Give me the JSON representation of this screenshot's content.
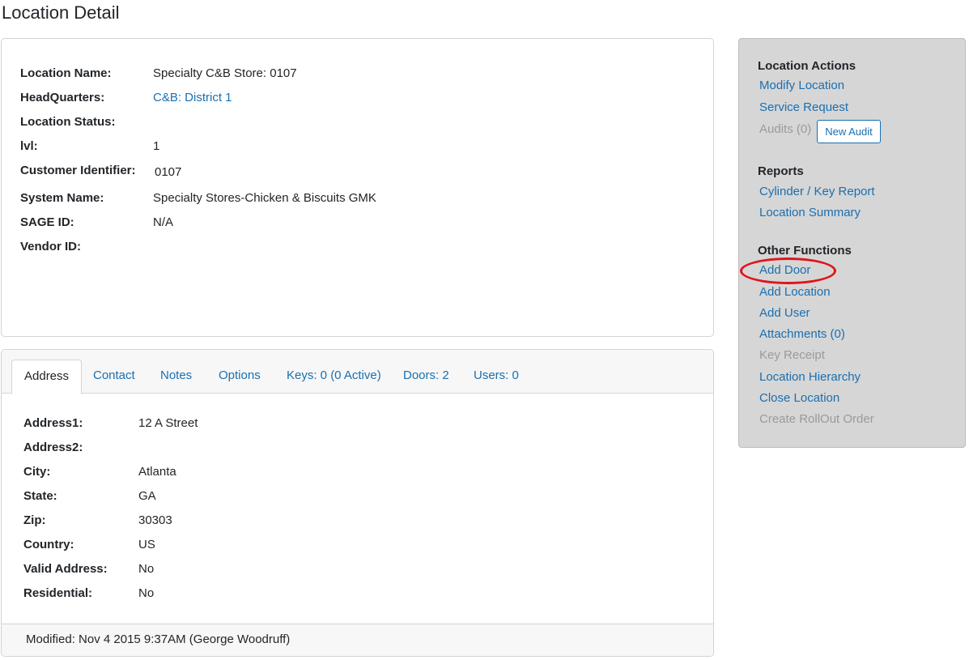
{
  "page": {
    "title": "Location Detail"
  },
  "detail": {
    "rows": [
      {
        "label": "Location Name:",
        "value": "Specialty C&B Store: 0107",
        "link": false
      },
      {
        "label": "HeadQuarters:",
        "value": "C&B: District 1",
        "link": true
      },
      {
        "label": "Location Status:",
        "value": "",
        "link": false
      },
      {
        "label": "lvl:",
        "value": "1",
        "link": false
      },
      {
        "label": "Customer Identifier:",
        "value": "0107",
        "link": false
      },
      {
        "label": "System Name:",
        "value": "Specialty Stores-Chicken & Biscuits GMK",
        "link": false
      },
      {
        "label": "SAGE ID:",
        "value": "N/A",
        "link": false
      },
      {
        "label": "Vendor ID:",
        "value": "",
        "link": false
      }
    ]
  },
  "tabs": [
    {
      "label": "Address",
      "active": true
    },
    {
      "label": "Contact",
      "active": false
    },
    {
      "label": "Notes",
      "active": false
    },
    {
      "label": "Options",
      "active": false
    },
    {
      "label": "Keys: 0 (0 Active)",
      "active": false
    },
    {
      "label": "Doors: 2",
      "active": false
    },
    {
      "label": "Users: 0",
      "active": false
    }
  ],
  "address": {
    "rows": [
      {
        "label": "Address1:",
        "value": "12 A Street"
      },
      {
        "label": "Address2:",
        "value": ""
      },
      {
        "label": "City:",
        "value": "Atlanta"
      },
      {
        "label": "State:",
        "value": "GA"
      },
      {
        "label": "Zip:",
        "value": "30303"
      },
      {
        "label": "Country:",
        "value": "US"
      },
      {
        "label": "Valid Address:",
        "value": "No"
      },
      {
        "label": "Residential:",
        "value": "No"
      }
    ],
    "modified": "Modified: Nov 4 2015 9:37AM (George Woodruff)"
  },
  "sidebar": {
    "location_actions": {
      "heading": "Location Actions",
      "modify_location": "Modify Location",
      "service_request": "Service Request",
      "audits": "Audits (0)",
      "new_audit": "New Audit"
    },
    "reports": {
      "heading": "Reports",
      "items": [
        "Cylinder / Key Report",
        "Location Summary"
      ]
    },
    "other_functions": {
      "heading": "Other Functions",
      "items": [
        {
          "label": "Add Door",
          "enabled": true,
          "highlighted": true
        },
        {
          "label": "Add Location",
          "enabled": true
        },
        {
          "label": "Add User",
          "enabled": true
        },
        {
          "label": "Attachments (0)",
          "enabled": true
        },
        {
          "label": "Key Receipt",
          "enabled": false
        },
        {
          "label": "Location Hierarchy",
          "enabled": true
        },
        {
          "label": "Close Location",
          "enabled": true
        },
        {
          "label": "Create RollOut Order",
          "enabled": false
        }
      ]
    },
    "highlight_color": "#e0141b",
    "link_color": "#1a6fb0"
  }
}
